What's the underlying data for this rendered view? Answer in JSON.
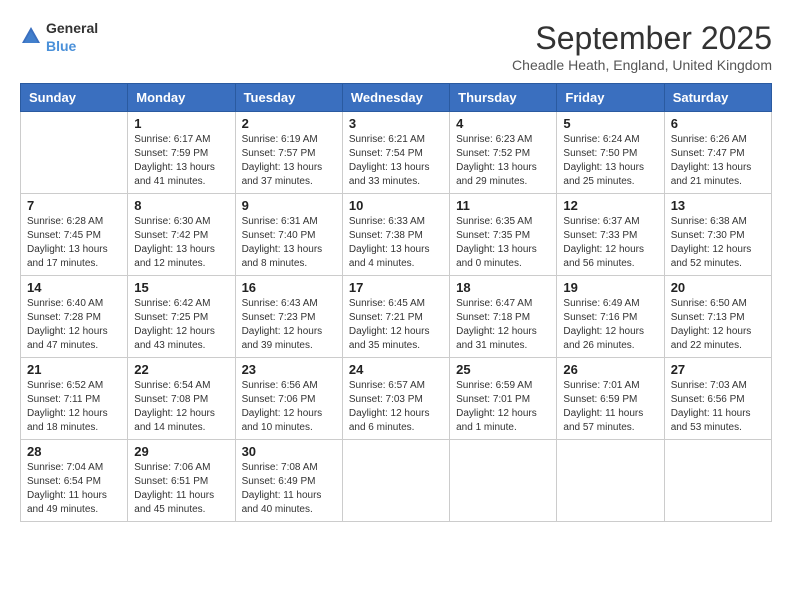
{
  "header": {
    "logo": {
      "general": "General",
      "blue": "Blue"
    },
    "title": "September 2025",
    "subtitle": "Cheadle Heath, England, United Kingdom"
  },
  "columns": [
    "Sunday",
    "Monday",
    "Tuesday",
    "Wednesday",
    "Thursday",
    "Friday",
    "Saturday"
  ],
  "weeks": [
    [
      {
        "day": "",
        "info": ""
      },
      {
        "day": "1",
        "info": "Sunrise: 6:17 AM\nSunset: 7:59 PM\nDaylight: 13 hours\nand 41 minutes."
      },
      {
        "day": "2",
        "info": "Sunrise: 6:19 AM\nSunset: 7:57 PM\nDaylight: 13 hours\nand 37 minutes."
      },
      {
        "day": "3",
        "info": "Sunrise: 6:21 AM\nSunset: 7:54 PM\nDaylight: 13 hours\nand 33 minutes."
      },
      {
        "day": "4",
        "info": "Sunrise: 6:23 AM\nSunset: 7:52 PM\nDaylight: 13 hours\nand 29 minutes."
      },
      {
        "day": "5",
        "info": "Sunrise: 6:24 AM\nSunset: 7:50 PM\nDaylight: 13 hours\nand 25 minutes."
      },
      {
        "day": "6",
        "info": "Sunrise: 6:26 AM\nSunset: 7:47 PM\nDaylight: 13 hours\nand 21 minutes."
      }
    ],
    [
      {
        "day": "7",
        "info": "Sunrise: 6:28 AM\nSunset: 7:45 PM\nDaylight: 13 hours\nand 17 minutes."
      },
      {
        "day": "8",
        "info": "Sunrise: 6:30 AM\nSunset: 7:42 PM\nDaylight: 13 hours\nand 12 minutes."
      },
      {
        "day": "9",
        "info": "Sunrise: 6:31 AM\nSunset: 7:40 PM\nDaylight: 13 hours\nand 8 minutes."
      },
      {
        "day": "10",
        "info": "Sunrise: 6:33 AM\nSunset: 7:38 PM\nDaylight: 13 hours\nand 4 minutes."
      },
      {
        "day": "11",
        "info": "Sunrise: 6:35 AM\nSunset: 7:35 PM\nDaylight: 13 hours\nand 0 minutes."
      },
      {
        "day": "12",
        "info": "Sunrise: 6:37 AM\nSunset: 7:33 PM\nDaylight: 12 hours\nand 56 minutes."
      },
      {
        "day": "13",
        "info": "Sunrise: 6:38 AM\nSunset: 7:30 PM\nDaylight: 12 hours\nand 52 minutes."
      }
    ],
    [
      {
        "day": "14",
        "info": "Sunrise: 6:40 AM\nSunset: 7:28 PM\nDaylight: 12 hours\nand 47 minutes."
      },
      {
        "day": "15",
        "info": "Sunrise: 6:42 AM\nSunset: 7:25 PM\nDaylight: 12 hours\nand 43 minutes."
      },
      {
        "day": "16",
        "info": "Sunrise: 6:43 AM\nSunset: 7:23 PM\nDaylight: 12 hours\nand 39 minutes."
      },
      {
        "day": "17",
        "info": "Sunrise: 6:45 AM\nSunset: 7:21 PM\nDaylight: 12 hours\nand 35 minutes."
      },
      {
        "day": "18",
        "info": "Sunrise: 6:47 AM\nSunset: 7:18 PM\nDaylight: 12 hours\nand 31 minutes."
      },
      {
        "day": "19",
        "info": "Sunrise: 6:49 AM\nSunset: 7:16 PM\nDaylight: 12 hours\nand 26 minutes."
      },
      {
        "day": "20",
        "info": "Sunrise: 6:50 AM\nSunset: 7:13 PM\nDaylight: 12 hours\nand 22 minutes."
      }
    ],
    [
      {
        "day": "21",
        "info": "Sunrise: 6:52 AM\nSunset: 7:11 PM\nDaylight: 12 hours\nand 18 minutes."
      },
      {
        "day": "22",
        "info": "Sunrise: 6:54 AM\nSunset: 7:08 PM\nDaylight: 12 hours\nand 14 minutes."
      },
      {
        "day": "23",
        "info": "Sunrise: 6:56 AM\nSunset: 7:06 PM\nDaylight: 12 hours\nand 10 minutes."
      },
      {
        "day": "24",
        "info": "Sunrise: 6:57 AM\nSunset: 7:03 PM\nDaylight: 12 hours\nand 6 minutes."
      },
      {
        "day": "25",
        "info": "Sunrise: 6:59 AM\nSunset: 7:01 PM\nDaylight: 12 hours\nand 1 minute."
      },
      {
        "day": "26",
        "info": "Sunrise: 7:01 AM\nSunset: 6:59 PM\nDaylight: 11 hours\nand 57 minutes."
      },
      {
        "day": "27",
        "info": "Sunrise: 7:03 AM\nSunset: 6:56 PM\nDaylight: 11 hours\nand 53 minutes."
      }
    ],
    [
      {
        "day": "28",
        "info": "Sunrise: 7:04 AM\nSunset: 6:54 PM\nDaylight: 11 hours\nand 49 minutes."
      },
      {
        "day": "29",
        "info": "Sunrise: 7:06 AM\nSunset: 6:51 PM\nDaylight: 11 hours\nand 45 minutes."
      },
      {
        "day": "30",
        "info": "Sunrise: 7:08 AM\nSunset: 6:49 PM\nDaylight: 11 hours\nand 40 minutes."
      },
      {
        "day": "",
        "info": ""
      },
      {
        "day": "",
        "info": ""
      },
      {
        "day": "",
        "info": ""
      },
      {
        "day": "",
        "info": ""
      }
    ]
  ]
}
